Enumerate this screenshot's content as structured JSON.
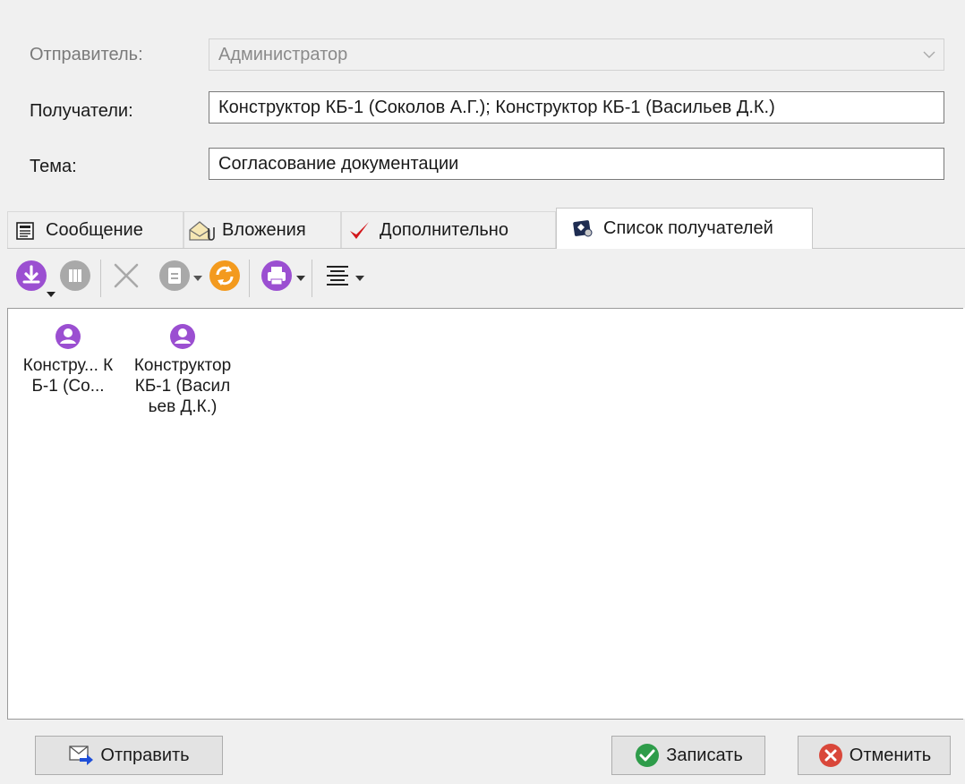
{
  "form": {
    "sender_label": "Отправитель:",
    "sender_value": "Администратор",
    "recipients_label": "Получатели:",
    "recipients_value": "Конструктор КБ-1 (Соколов А.Г.); Конструктор КБ-1 (Васильев Д.К.)",
    "subject_label": "Тема:",
    "subject_value": "Согласование документации"
  },
  "tabs": [
    {
      "label": "Сообщение",
      "icon": "message-icon",
      "active": false
    },
    {
      "label": "Вложения",
      "icon": "attachments-icon",
      "active": false
    },
    {
      "label": "Дополнительно",
      "icon": "checkmark-icon",
      "active": false
    },
    {
      "label": "Список получателей",
      "icon": "recipients-list-icon",
      "active": true
    }
  ],
  "toolbar": {
    "icons": [
      "download-icon",
      "delete-icon",
      "close-icon",
      "edit-icon",
      "refresh-icon",
      "print-icon",
      "align-icon"
    ]
  },
  "recipients": [
    {
      "label": "Констру... КБ-1 (Со...",
      "icon": "user-icon"
    },
    {
      "label": "Конструктор КБ-1 (Васильев Д.К.)",
      "icon": "user-icon"
    }
  ],
  "buttons": {
    "send": "Отправить",
    "save": "Записать",
    "cancel": "Отменить"
  },
  "colors": {
    "accent_purple": "#9b4fd1",
    "refresh_orange": "#f39a1e",
    "save_green": "#2e9c4a",
    "cancel_red": "#d9473a",
    "check_red": "#d3171b",
    "disabled_gray": "#a9a9a9"
  }
}
